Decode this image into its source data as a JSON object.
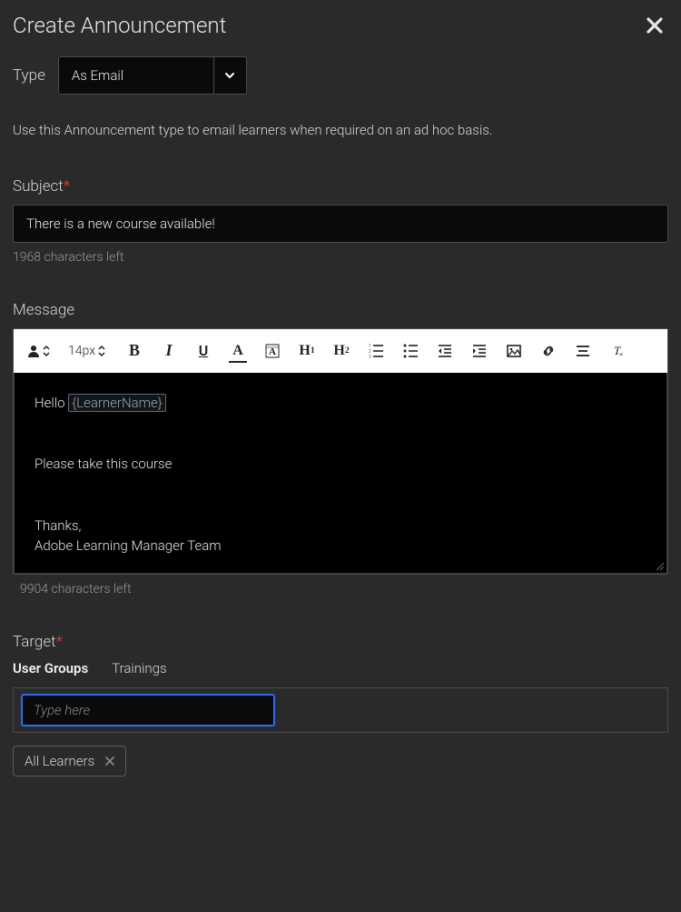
{
  "header": {
    "title": "Create Announcement"
  },
  "type": {
    "label": "Type",
    "selected": "As Email"
  },
  "description": "Use this Announcement type to email learners when required on an ad hoc basis.",
  "subject": {
    "label": "Subject",
    "value": "There is a new course available!",
    "chars_left": "1968 characters left"
  },
  "message": {
    "label": "Message",
    "font_size": "14px",
    "body": {
      "greeting_prefix": "Hello ",
      "placeholder_token": "{LearnerName}",
      "line2": "Please take this course",
      "signoff1": "Thanks,",
      "signoff2": "Adobe Learning Manager Team"
    },
    "chars_left": "9904 characters left"
  },
  "target": {
    "label": "Target",
    "tabs": {
      "user_groups": "User Groups",
      "trainings": "Trainings"
    },
    "input_placeholder": "Type here",
    "chips": [
      "All Learners"
    ]
  }
}
